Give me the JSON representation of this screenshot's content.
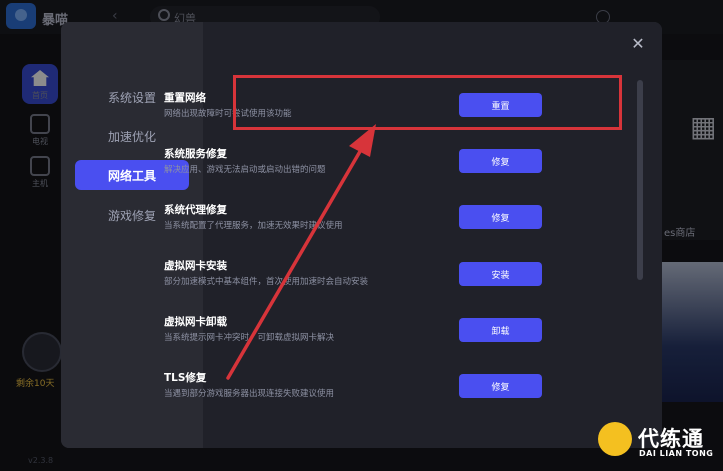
{
  "background": {
    "app_name": "暴喵",
    "search_text": "幻兽",
    "nav": [
      {
        "label": "首页",
        "icon": "home-icon"
      },
      {
        "label": "电视",
        "icon": "tv-icon"
      },
      {
        "label": "主机",
        "icon": "console-icon"
      }
    ],
    "days_left": "剩余10天",
    "right_label": "es商店",
    "version": "v2.3.8"
  },
  "modal": {
    "sidebar": [
      {
        "label": "系统设置",
        "active": false
      },
      {
        "label": "加速优化",
        "active": false
      },
      {
        "label": "网络工具",
        "active": true
      },
      {
        "label": "游戏修复",
        "active": false
      }
    ],
    "close_icon": "close-icon",
    "tools": [
      {
        "title": "重置网络",
        "desc": "网络出现故障时可尝试使用该功能",
        "button": "重置",
        "highlighted": true
      },
      {
        "title": "系统服务修复",
        "desc": "解决应用、游戏无法启动或启动出错的问题",
        "button": "修复"
      },
      {
        "title": "系统代理修复",
        "desc": "当系统配置了代理服务，加速无效果时建议使用",
        "button": "修复"
      },
      {
        "title": "虚拟网卡安装",
        "desc": "部分加速模式中基本组件，首次使用加速时会自动安装",
        "button": "安装"
      },
      {
        "title": "虚拟网卡卸载",
        "desc": "当系统提示网卡冲突时，可卸载虚拟网卡解决",
        "button": "卸载"
      },
      {
        "title": "TLS修复",
        "desc": "当遇到部分游戏服务器出现连接失败建议使用",
        "button": "修复"
      }
    ]
  },
  "annotation": {
    "color": "#d7343a"
  },
  "watermark": {
    "cn": "代练通",
    "en": "DAI LIAN TONG"
  },
  "colors": {
    "accent": "#4a4ff0",
    "highlight": "#d7343a",
    "modal_bg": "#2a2b33",
    "content_bg": "#202129"
  }
}
